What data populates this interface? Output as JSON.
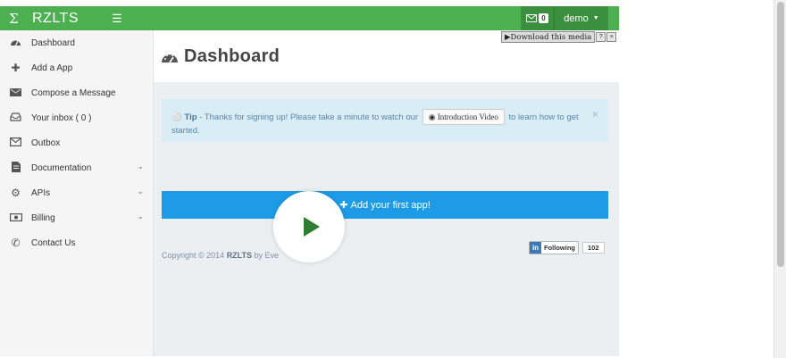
{
  "topbar": {
    "brand_name": "RZLTS",
    "messages_count": "0",
    "user_name": "demo"
  },
  "sidebar": {
    "items": [
      {
        "label": "Dashboard",
        "icon": "dashboard-icon"
      },
      {
        "label": "Add a App",
        "icon": "plus-icon"
      },
      {
        "label": "Compose a Message",
        "icon": "compose-icon"
      },
      {
        "label": "Your inbox ( 0 )",
        "icon": "inbox-icon"
      },
      {
        "label": "Outbox",
        "icon": "outbox-icon"
      },
      {
        "label": "Documentation",
        "icon": "document-icon"
      },
      {
        "label": "APIs",
        "icon": "gears-icon"
      },
      {
        "label": "Billing",
        "icon": "money-icon"
      },
      {
        "label": "Contact Us",
        "icon": "phone-icon"
      }
    ]
  },
  "main": {
    "title": "Dashboard",
    "tip": {
      "label": "Tip",
      "text_before": " - Thanks for signing up! Please take a minute to watch our ",
      "button": "Introduction Video",
      "text_after": " to learn how to get started."
    },
    "cta_label": "Add your first app!",
    "footer": {
      "prefix": "Copyright © 2014 ",
      "brand": "RZLTS",
      "suffix": " by Eve"
    },
    "linkedin": {
      "logo": "in",
      "label": "Following",
      "count": "102"
    }
  },
  "overlay": {
    "download_label": "Download this media"
  },
  "colors": {
    "topbar": "#4caf50",
    "cta": "#1e9be6",
    "tip_bg": "#d9edf7",
    "play": "#2e7d32"
  }
}
